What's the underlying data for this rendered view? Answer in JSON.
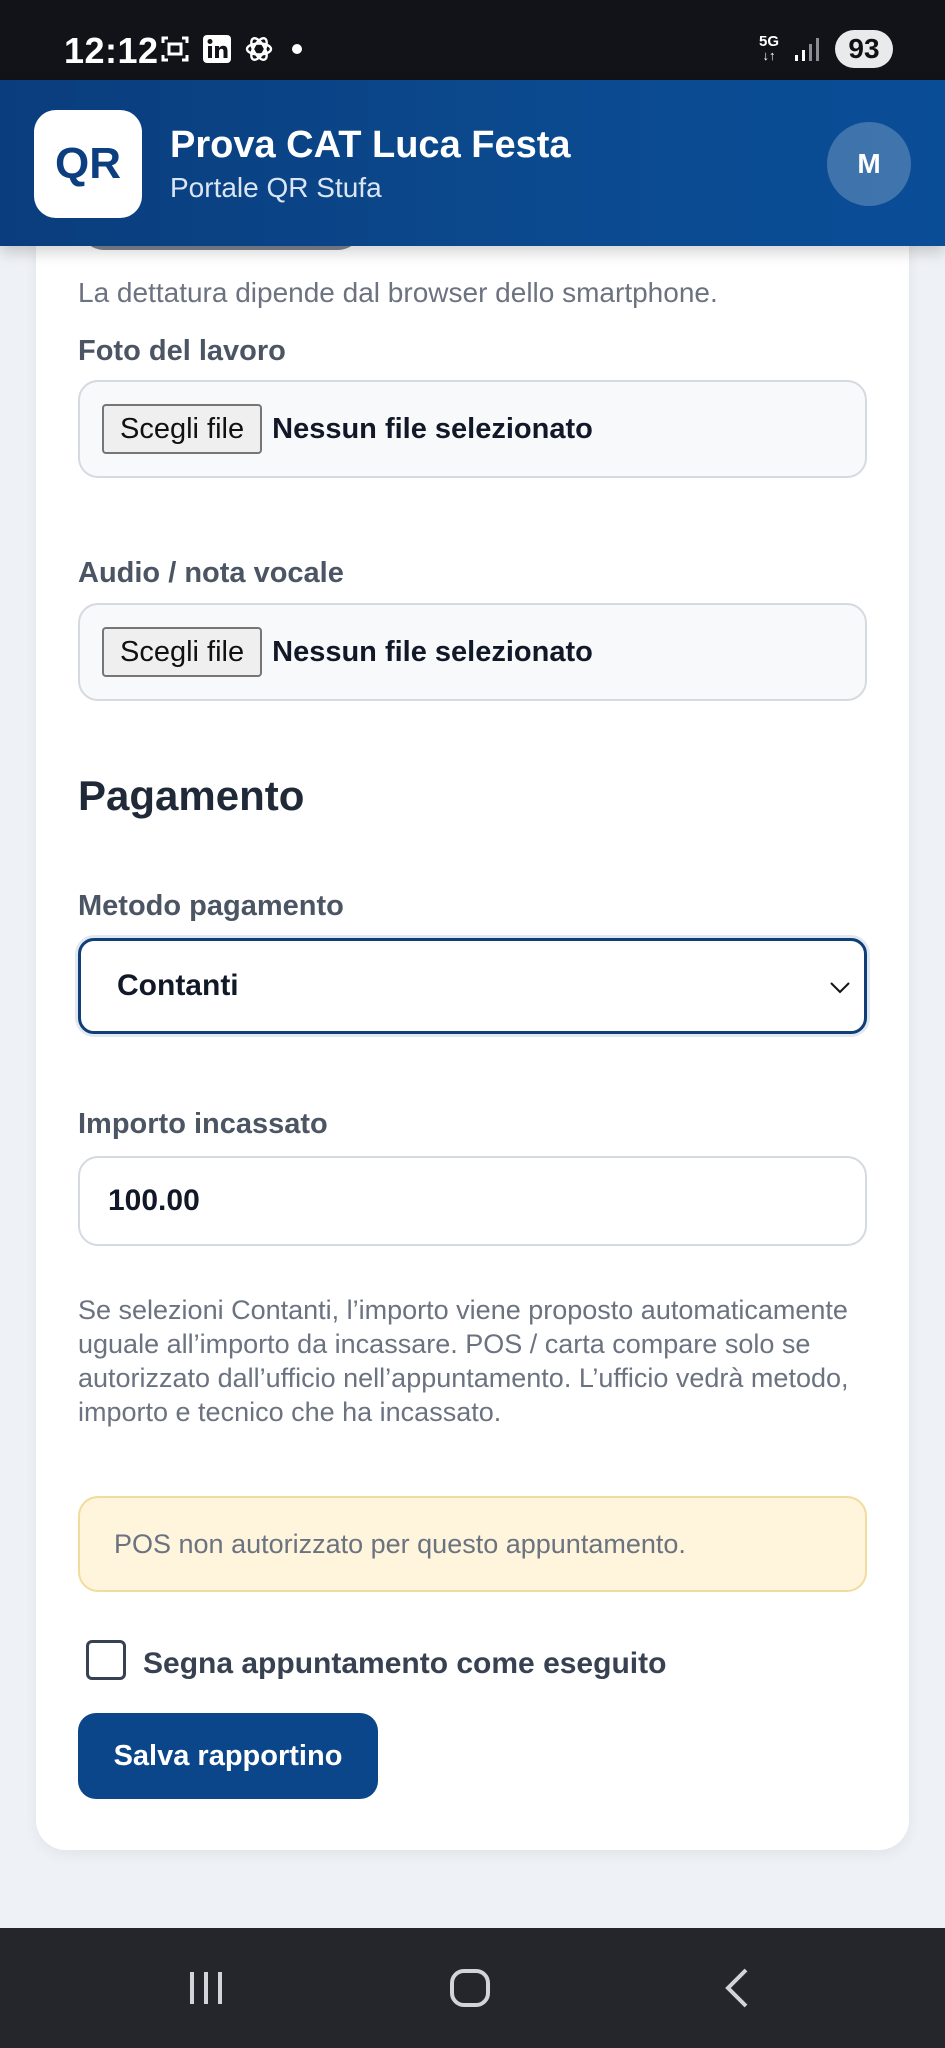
{
  "status_bar": {
    "time": "12:12",
    "network": "5G",
    "battery": "93"
  },
  "header": {
    "logo": "QR",
    "title": "Prova CAT Luca Festa",
    "subtitle": "Portale QR Stufa",
    "avatar_initial": "M"
  },
  "form": {
    "dictation_hint": "La dettatura dipende dal browser dello smartphone.",
    "photo": {
      "label": "Foto del lavoro",
      "button": "Scegli file",
      "status": "Nessun file selezionato"
    },
    "audio": {
      "label": "Audio / nota vocale",
      "button": "Scegli file",
      "status": "Nessun file selezionato"
    },
    "payment": {
      "section_title": "Pagamento",
      "method_label": "Metodo pagamento",
      "method_value": "Contanti",
      "amount_label": "Importo incassato",
      "amount_value": "100.00",
      "info_text": "Se selezioni Contanti, l’importo viene proposto automaticamente uguale all’importo da incassare. POS / carta compare solo se autorizzato dall’ufficio nell’appuntamento. L’ufficio vedrà metodo, importo e tecnico che ha incassato.",
      "warning": "POS non autorizzato per questo appuntamento."
    },
    "done_checkbox_label": "Segna appuntamento come eseguito",
    "save_button": "Salva rapportino"
  },
  "icons": {
    "status": [
      "screenshot-icon",
      "linkedin-icon",
      "openai-icon",
      "notification-dot-icon",
      "signal-icon"
    ],
    "nav": [
      "recent-apps-icon",
      "home-icon",
      "back-icon"
    ],
    "select": "chevron-down-icon"
  },
  "colors": {
    "header": "#0b4a8f",
    "primary_button": "#0a4689",
    "warning_bg": "#fff4dc",
    "warning_border": "#f2dc9b"
  }
}
